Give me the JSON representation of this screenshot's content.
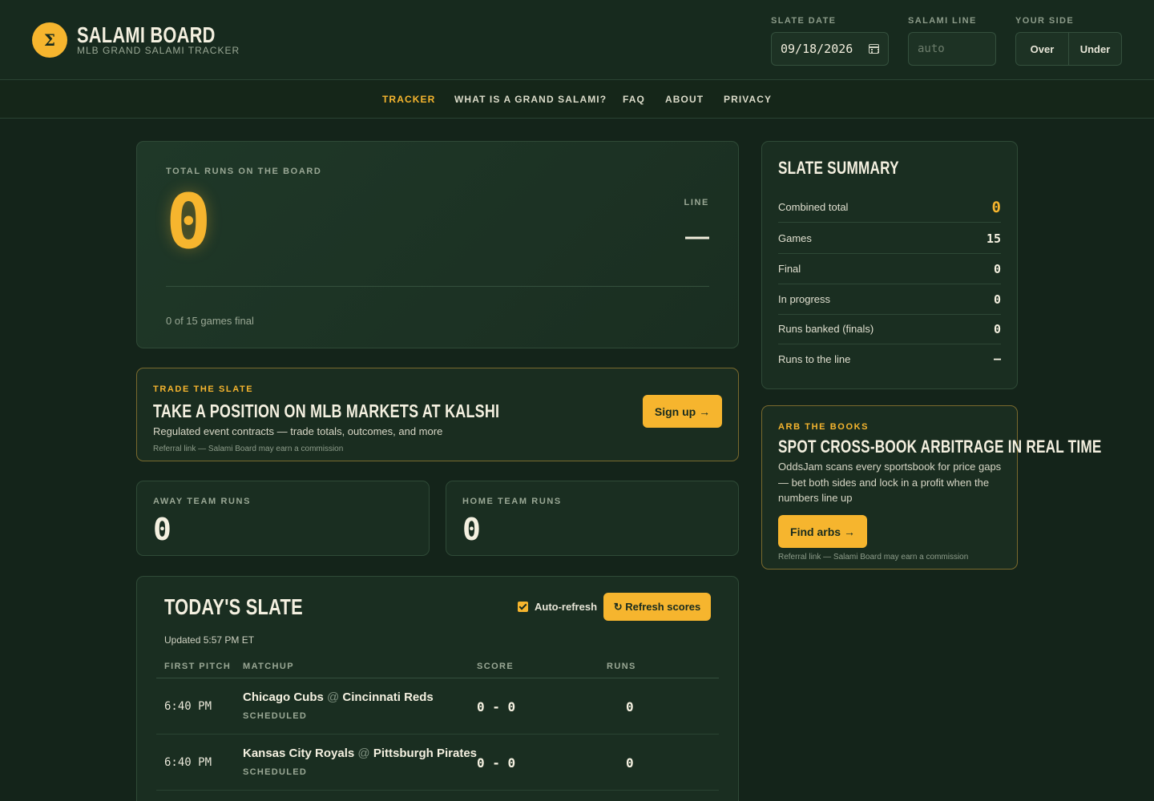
{
  "header": {
    "brand_icon": "Σ",
    "brand_title": "SALAMI BOARD",
    "brand_subtitle": "MLB GRAND SALAMI TRACKER",
    "slate_date_label": "SLATE DATE",
    "slate_date_value": "09/18/2026",
    "salami_line_label": "SALAMI LINE",
    "salami_line_placeholder": "auto",
    "your_side_label": "YOUR SIDE",
    "side_over": "Over",
    "side_under": "Under"
  },
  "nav": {
    "items": [
      {
        "label": "TRACKER",
        "active": true
      },
      {
        "label": "WHAT IS A GRAND SALAMI?"
      },
      {
        "label": "FAQ"
      },
      {
        "label": "ABOUT"
      },
      {
        "label": "PRIVACY"
      }
    ]
  },
  "hero": {
    "label": "TOTAL RUNS ON THE BOARD",
    "total": "0",
    "line_label": "LINE",
    "line_value": "—",
    "final_note": "0 of 15 games final"
  },
  "kalshi": {
    "eyebrow": "TRADE THE SLATE",
    "title": "TAKE A POSITION ON MLB MARKETS AT KALSHI",
    "desc": "Regulated event contracts — trade totals, outcomes, and more",
    "ref": "Referral link — Salami Board may earn a commission",
    "button": "Sign up →"
  },
  "away": {
    "label": "AWAY TEAM RUNS",
    "value": "0"
  },
  "home": {
    "label": "HOME TEAM RUNS",
    "value": "0"
  },
  "slate": {
    "title": "TODAY'S SLATE",
    "auto_refresh": "Auto-refresh",
    "refresh_button": "↻ Refresh scores",
    "updated": "Updated 5:57 PM ET",
    "columns": [
      "FIRST PITCH",
      "MATCHUP",
      "SCORE",
      "RUNS"
    ],
    "games": [
      {
        "time": "6:40 PM",
        "away": "Chicago Cubs",
        "at": "@",
        "home": "Cincinnati Reds",
        "status": "SCHEDULED",
        "score": "0 - 0",
        "runs": "0"
      },
      {
        "time": "6:40 PM",
        "away": "Kansas City Royals",
        "at": "@",
        "home": "Pittsburgh Pirates",
        "status": "SCHEDULED",
        "score": "0 - 0",
        "runs": "0"
      }
    ]
  },
  "summary": {
    "title": "SLATE SUMMARY",
    "rows": [
      {
        "k": "Combined total",
        "v": "0"
      },
      {
        "k": "Games",
        "v": "15"
      },
      {
        "k": "Final",
        "v": "0"
      },
      {
        "k": "In progress",
        "v": "0"
      },
      {
        "k": "Runs banked (finals)",
        "v": "0"
      },
      {
        "k": "Runs to the line",
        "v": "—"
      }
    ]
  },
  "arb": {
    "eyebrow": "ARB THE BOOKS",
    "title": "SPOT CROSS-BOOK ARBITRAGE IN REAL TIME",
    "desc": "OddsJam scans every sportsbook for price gaps — bet both sides and lock in a profit when the numbers line up",
    "button": "Find arbs →",
    "ref": "Referral link — Salami Board may earn a commission"
  },
  "colors": {
    "accent": "#f6b52e",
    "bg": "#14241a",
    "card": "#1a2e21"
  }
}
